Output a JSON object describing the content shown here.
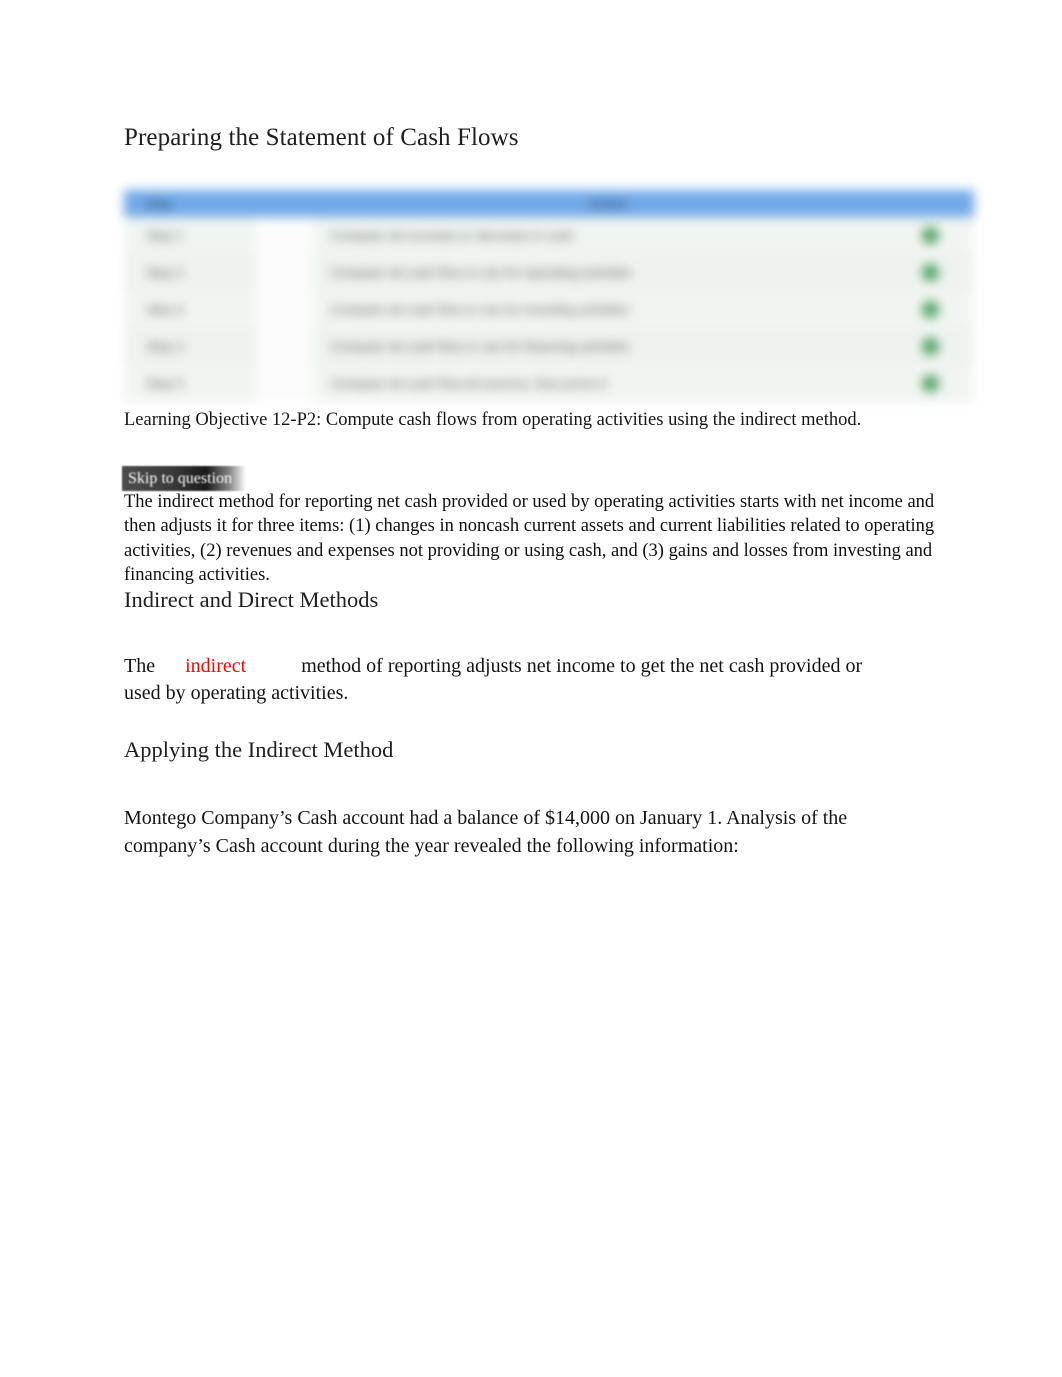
{
  "document": {
    "title": "Preparing the Statement of Cash Flows"
  },
  "figure": {
    "name": "statement-of-cash-flows-steps-table",
    "header_colour": "#72a9e8",
    "marker_colour": "#4f9e62",
    "columns": [
      "Step",
      "",
      "Action",
      ""
    ],
    "rows": [
      {
        "step": "Step 1",
        "action": "Compute net increase or decrease in cash",
        "marker": "●"
      },
      {
        "step": "Step 2",
        "action": "Compute net cash flow or use for operating activities",
        "marker": "●"
      },
      {
        "step": "Step 3",
        "action": "Compute net cash flow or use for investing activities",
        "marker": "●"
      },
      {
        "step": "Step 4",
        "action": "Compute net cash flow or use for financing activities",
        "marker": "●"
      },
      {
        "step": "Step 5",
        "action": "Compute net cash flow all sources, then prove it",
        "marker": "●"
      }
    ]
  },
  "learning_objective": {
    "text": "Learning Objective 12-P2: Compute cash flows from operating activities using the indirect method."
  },
  "skip_link": {
    "label": "Skip to question"
  },
  "intro_paragraph": {
    "text": "The indirect method for reporting net cash provided or used by operating activities starts with net income and then adjusts it for three items: (1) changes in noncash current assets and current liabilities related to operating activities, (2) revenues and expenses not providing or using cash, and (3) gains and losses from investing and financing activities."
  },
  "sections": {
    "methods_heading": "Indirect and Direct Methods",
    "applying_heading": "Applying the Indirect Method"
  },
  "fill_in_blank": {
    "before": "The ",
    "blank_prefix": "__",
    "answer": "indirect",
    "answer_colour": "#ff0000",
    "blank_suffix": "_____",
    "after": " method of reporting adjusts net income to get the net cash provided or used by operating activities."
  },
  "montego_paragraph": {
    "text": "Montego Company’s Cash account had a balance of $14,000 on January 1. Analysis of the company’s Cash account during the year revealed the following information:"
  }
}
